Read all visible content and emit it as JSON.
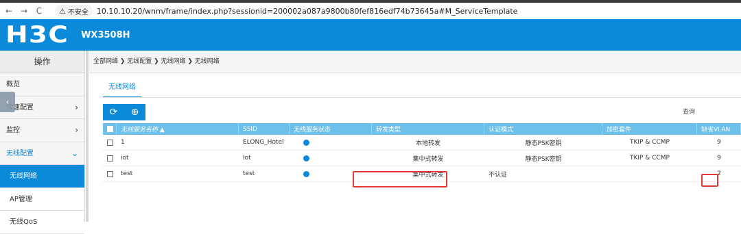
{
  "browser": {
    "back": "←",
    "forward": "→",
    "reload": "C",
    "security_label": "不安全",
    "url": "10.10.10.20/wnm/frame/index.php?sessionid=200002a087a9800b80fef816edf74b73645a#M_ServiceTemplate"
  },
  "header": {
    "logo": "H3C",
    "model": "WX3508H"
  },
  "sidebar": {
    "title": "操作",
    "items": [
      {
        "label": "概览",
        "arrow": ""
      },
      {
        "label": "快速配置",
        "arrow": "›"
      },
      {
        "label": "监控",
        "arrow": "›"
      },
      {
        "label": "无线配置",
        "arrow": "⌄"
      },
      {
        "label": "无线网络",
        "arrow": ""
      },
      {
        "label": "AP管理",
        "arrow": ""
      },
      {
        "label": "无线QoS",
        "arrow": ""
      }
    ],
    "collapse": "‹"
  },
  "breadcrumb": "全部网络 ❯ 无线配置 ❯ 无线网络 ❯ 无线网络",
  "tab": "无线网络",
  "toolbar": {
    "refresh": "⟳",
    "add": "⊕"
  },
  "search": {
    "placeholder": "查询"
  },
  "table": {
    "headers": [
      "无线服务名称 ▲",
      "SSID",
      "无线服务状态",
      "转发类型",
      "认证模式",
      "加密套件",
      "缺省VLAN"
    ],
    "rows": [
      {
        "name": "1",
        "ssid": "ELONG_Hotel",
        "forward": "本地转发",
        "auth": "静态PSK密钥",
        "cipher": "TKIP & CCMP",
        "vlan": "9"
      },
      {
        "name": "iot",
        "ssid": "Iot",
        "forward": "集中式转发",
        "auth": "静态PSK密钥",
        "cipher": "TKIP & CCMP",
        "vlan": "9"
      },
      {
        "name": "test",
        "ssid": "test",
        "forward": "集中式转发",
        "auth": "不认证",
        "cipher": "",
        "vlan": "2"
      }
    ]
  },
  "colors": {
    "brand": "#0a8ad8",
    "table_header": "#6cc0ea",
    "highlight": "#e53935"
  }
}
